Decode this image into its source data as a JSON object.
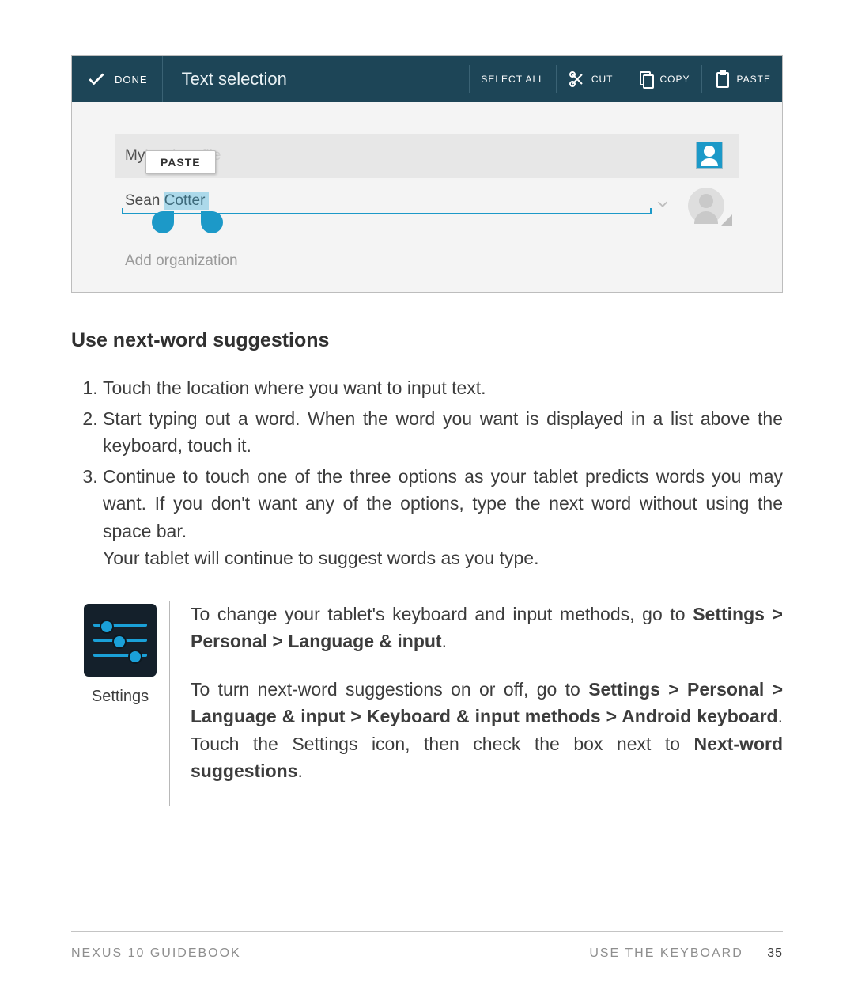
{
  "cab": {
    "done": "DONE",
    "title": "Text selection",
    "select_all": "SELECT ALL",
    "cut": "CUT",
    "copy": "COPY",
    "paste": "PASTE"
  },
  "shot": {
    "profile_prefix": "My ",
    "profile_masked": "local profile",
    "profile_visible": "le",
    "paste_popup": "PASTE",
    "name": "Sean Cotter",
    "add_org": "Add organization"
  },
  "heading": "Use next-word suggestions",
  "steps": [
    "Touch the location where you want to input text.",
    "Start typing out a word. When the word you want is displayed in a list above the keyboard, touch it.",
    "Continue to touch one of the three options as your tablet predicts words you may want. If you don't want any of the options, type the next word without using the space bar.\nYour tablet will continue to suggest words as you type."
  ],
  "note": {
    "icon_label": "Settings",
    "p1_a": "To change your tablet's keyboard and input methods, go to ",
    "p1_b": "Settings > Personal > Language & input",
    "p1_c": ".",
    "p2_a": "To turn next-word suggestions on or off, go to ",
    "p2_b": "Settings > Personal > Language & input > Keyboard & input methods > Android keyboard",
    "p2_c": ". Touch the Settings icon, then check the box next to ",
    "p2_d": "Next-word suggestions",
    "p2_e": "."
  },
  "footer": {
    "left": "NEXUS 10 GUIDEBOOK",
    "right": "USE THE KEYBOARD",
    "page": "35"
  }
}
